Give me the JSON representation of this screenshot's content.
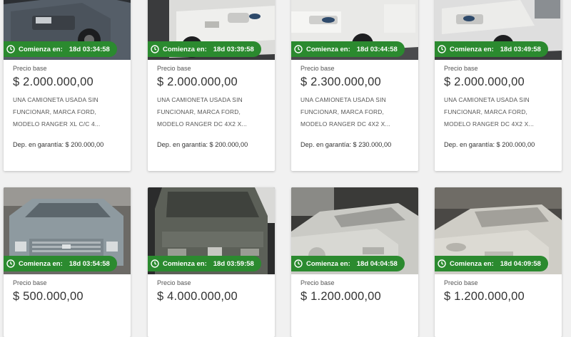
{
  "listings": [
    {
      "countdown_label": "Comienza en:",
      "countdown": "18d 03:34:58",
      "base_label": "Precio base",
      "price": "$ 2.000.000,00",
      "description": "UNA CAMIONETA USADA SIN FUNCIONAR, MARCA FORD, MODELO RANGER XL C/C 4...",
      "deposit": "Dep. en garantía: $ 200.000,00",
      "vehicle_color": "#5a6470"
    },
    {
      "countdown_label": "Comienza en:",
      "countdown": "18d 03:39:58",
      "base_label": "Precio base",
      "price": "$ 2.000.000,00",
      "description": "UNA CAMIONETA USADA SIN FUNCIONAR, MARCA FORD, MODELO RANGER DC 4X2 X...",
      "deposit": "Dep. en garantía: $ 200.000,00",
      "vehicle_color": "#e8e8e6"
    },
    {
      "countdown_label": "Comienza en:",
      "countdown": "18d 03:44:58",
      "base_label": "Precio base",
      "price": "$ 2.300.000,00",
      "description": "UNA CAMIONETA USADA SIN FUNCIONAR, MARCA FORD, MODELO RANGER DC 4X2 X...",
      "deposit": "Dep. en garantía: $ 230.000,00",
      "vehicle_color": "#ecebe8"
    },
    {
      "countdown_label": "Comienza en:",
      "countdown": "18d 03:49:58",
      "base_label": "Precio base",
      "price": "$ 2.000.000,00",
      "description": "UNA CAMIONETA USADA SIN FUNCIONAR, MARCA FORD, MODELO RANGER DC 4X2 X...",
      "deposit": "Dep. en garantía: $ 200.000,00",
      "vehicle_color": "#e4e4e2"
    },
    {
      "countdown_label": "Comienza en:",
      "countdown": "18d 03:54:58",
      "base_label": "Precio base",
      "price": "$ 500.000,00",
      "vehicle_color": "#8e9aa0"
    },
    {
      "countdown_label": "Comienza en:",
      "countdown": "18d 03:59:58",
      "base_label": "Precio base",
      "price": "$ 4.000.000,00",
      "vehicle_color": "#5c6058"
    },
    {
      "countdown_label": "Comienza en:",
      "countdown": "18d 04:04:58",
      "base_label": "Precio base",
      "price": "$ 1.200.000,00",
      "vehicle_color": "#c9c9c4"
    },
    {
      "countdown_label": "Comienza en:",
      "countdown": "18d 04:09:58",
      "base_label": "Precio base",
      "price": "$ 1.200.000,00",
      "vehicle_color": "#cfcdc6"
    }
  ],
  "colors": {
    "badge": "#2b8a2f",
    "card": "#ffffff",
    "background": "#f1f1f1"
  },
  "icons": {
    "countdown": "clock-icon"
  }
}
